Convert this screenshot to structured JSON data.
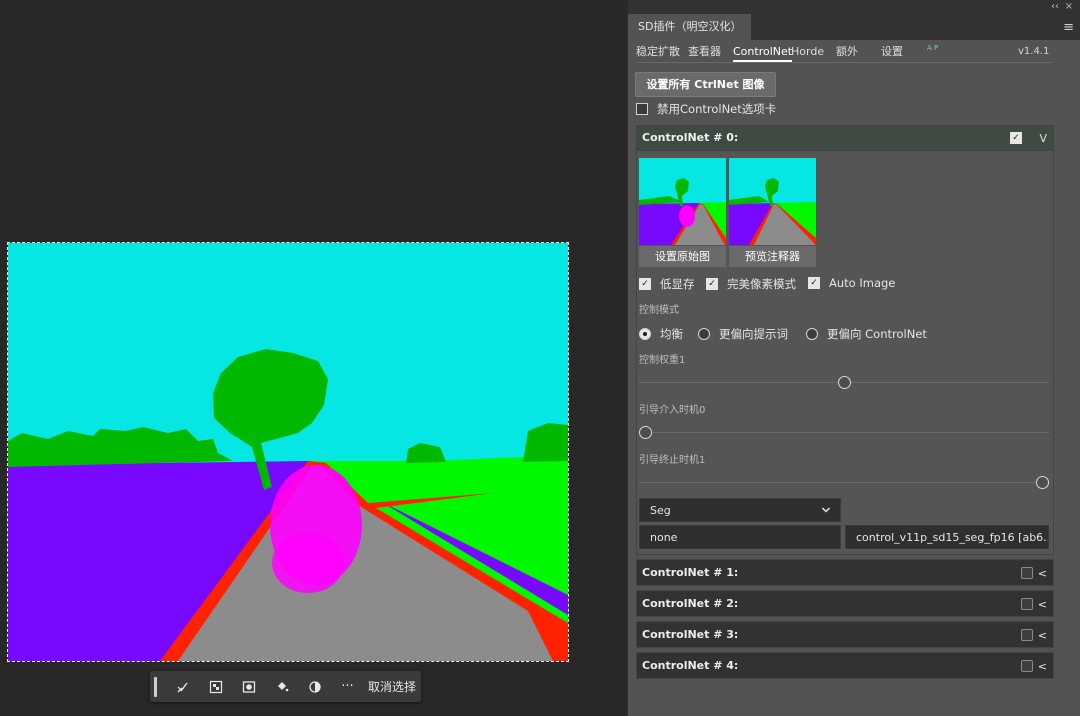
{
  "canvas": {
    "colors": {
      "sky": "#06e6e3",
      "trees": "#00b800",
      "grass": "#00f900",
      "left_field": "#7808ff",
      "road": "#8c8c8c",
      "road_edge": "#ff2200",
      "person": "#ff00ff",
      "selection": "#ffffff"
    }
  },
  "bottom_toolbar": {
    "icons": [
      "brush-check-icon",
      "grid-select-icon",
      "mask-icon",
      "fill-bucket-icon",
      "contrast-icon",
      "more-icon"
    ],
    "more_label": "···",
    "deselect_label": "取消选择"
  },
  "panel": {
    "tab_label": "SD插件（明空汉化）",
    "collapse_label": "‹‹",
    "close_label": "×",
    "menu_label": "≡",
    "subtabs": {
      "stable_diffusion": "稳定扩散",
      "viewer": "查看器",
      "controlnet": "ControlNet",
      "horde": "Horde",
      "extra": "额外",
      "settings": "设置",
      "ap": "A P",
      "version": "v1.4.1"
    },
    "set_all_button": "设置所有 CtrlNet 图像",
    "disable_tab_label": "禁用ControlNet选项卡",
    "unit0": {
      "title": "ControlNet # 0:",
      "arrow": "V",
      "set_source_button": "设置原始图",
      "preview_button": "预览注释器",
      "low_vram": "低显存",
      "pixel_perfect": "完美像素模式",
      "auto_image": "Auto Image",
      "control_mode_label": "控制模式",
      "mode_balanced": "均衡",
      "mode_prompt": "更偏向提示词",
      "mode_controlnet": "更偏向 ControlNet",
      "weight_label": "控制权重1",
      "weight_value": 0.5,
      "start_label": "引导介入时机0",
      "start_value": 0,
      "end_label": "引导终止时机1",
      "end_value": 1,
      "preprocessor_select": "Seg",
      "preprocessor": "none",
      "model": "control_v11p_sd15_seg_fp16 [ab6..."
    },
    "collapsed_units": [
      {
        "title": "ControlNet # 1:",
        "arrow": "<"
      },
      {
        "title": "ControlNet # 2:",
        "arrow": "<"
      },
      {
        "title": "ControlNet # 3:",
        "arrow": "<"
      },
      {
        "title": "ControlNet # 4:",
        "arrow": "<"
      }
    ]
  }
}
